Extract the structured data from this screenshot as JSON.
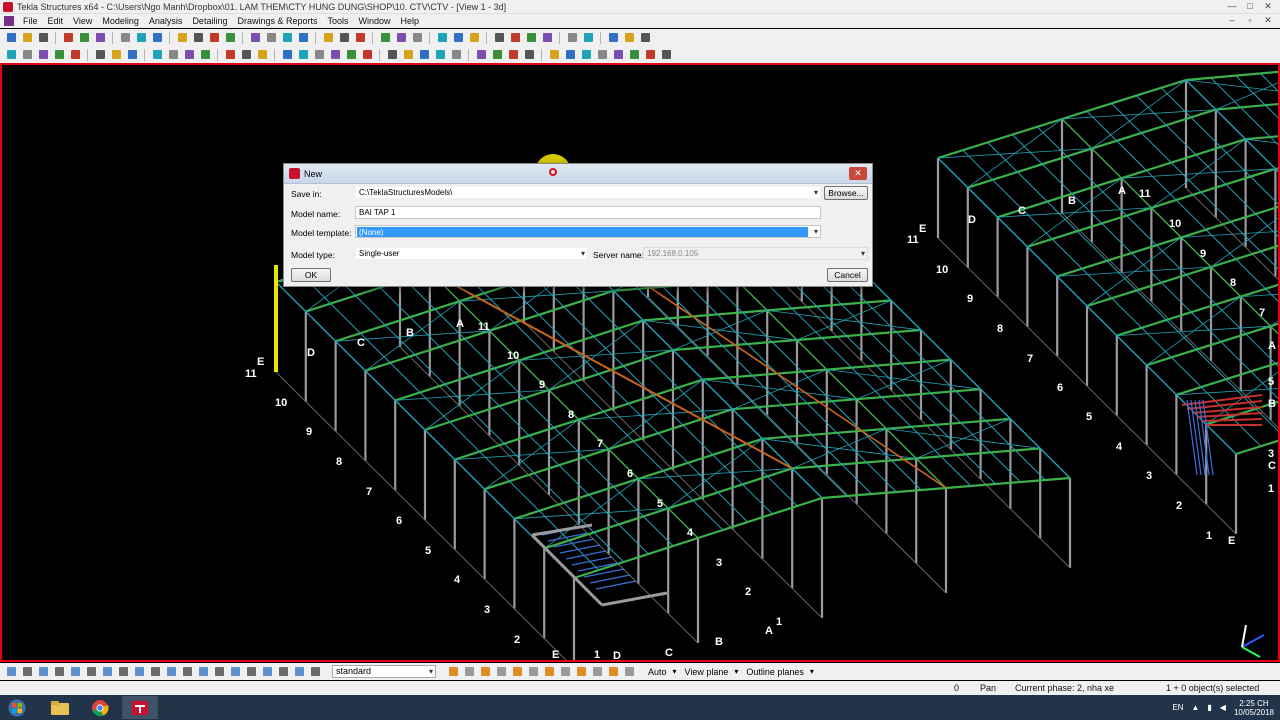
{
  "window": {
    "title": "Tekla Structures x64 - C:\\Users\\Ngo Manh\\Dropbox\\01. LAM THEM\\CTY HUNG DUNG\\SHOP\\10. CTV\\CTV  - [View 1 - 3d]",
    "controls": [
      "—",
      "□",
      "✕"
    ]
  },
  "menu": [
    "File",
    "Edit",
    "View",
    "Modeling",
    "Analysis",
    "Detailing",
    "Drawings & Reports",
    "Tools",
    "Window",
    "Help"
  ],
  "mdi_controls": [
    "–",
    "▫",
    "✕"
  ],
  "dialog": {
    "title": "New",
    "save_in_label": "Save in:",
    "save_in_value": "C:\\TeklaStructuresModels\\",
    "browse_label": "Browse...",
    "model_name_label": "Model name:",
    "model_name_value": "BAI TAP 1",
    "model_template_label": "Model template:",
    "model_template_value": "(None)",
    "model_type_label": "Model type:",
    "model_type_value": "Single-user",
    "server_name_label": "Server name:",
    "server_name_value": "192.168.0.105",
    "ok_label": "OK",
    "cancel_label": "Cancel"
  },
  "grid_labels_left": {
    "numbers": [
      "11",
      "10",
      "9",
      "8",
      "7",
      "6",
      "5",
      "4",
      "3",
      "2",
      "1"
    ],
    "letters": [
      "E",
      "D",
      "C",
      "B",
      "A"
    ],
    "ridge_numbers": [
      "11",
      "10",
      "9",
      "8",
      "7",
      "6",
      "5",
      "4",
      "3"
    ],
    "ridge_letters": [
      "D",
      "C",
      "B",
      "A"
    ],
    "end_numbers": [
      "2",
      "1"
    ],
    "end_letters": [
      "E",
      "D",
      "C",
      "B",
      "A"
    ]
  },
  "grid_labels_right": {
    "numbers": [
      "11",
      "10",
      "9",
      "8",
      "7",
      "6",
      "5",
      "4",
      "3",
      "2",
      "1"
    ],
    "letters": [
      "E",
      "D",
      "C",
      "B",
      "A"
    ],
    "ridge_numbers": [
      "11",
      "10",
      "9",
      "8",
      "7"
    ],
    "side_letters": [
      "A",
      "5",
      "B",
      "3",
      "C",
      "1"
    ],
    "end_letter": "E"
  },
  "bottombar": {
    "view_filter": "standard",
    "snap_mode": "Auto",
    "view_plane": "View plane",
    "outline_planes": "Outline planes"
  },
  "status": {
    "count": "0",
    "mode": "Pan",
    "phase": "Current phase: 2, nha xe",
    "selection": "1 + 0 object(s) selected"
  },
  "taskbar": {
    "language": "EN",
    "time": "2:25 CH",
    "date": "10/05/2018"
  },
  "colors": {
    "viewport_border": "#e60012",
    "purlin": "#1fa3b8",
    "rafter": "#3cb04a",
    "column": "#9a9aa0",
    "brace": "#c8641e",
    "selection_highlight": "#3399ff"
  }
}
